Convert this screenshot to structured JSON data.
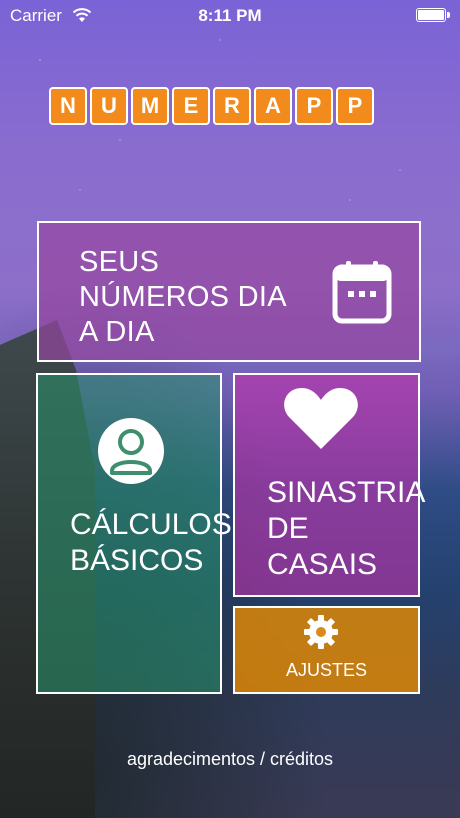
{
  "status_bar": {
    "carrier": "Carrier",
    "time": "8:11 PM",
    "battery_level": 1.0
  },
  "logo": {
    "letters": [
      "N",
      "U",
      "M",
      "E",
      "R",
      "A",
      "P",
      "P"
    ]
  },
  "tiles": {
    "daily": {
      "label_lines": [
        "SEUS",
        "NÚMEROS DIA",
        "A DIA"
      ],
      "icon": "calendar-icon"
    },
    "basic": {
      "label_lines": [
        "CÁLCULOS",
        "BÁSICOS"
      ],
      "icon": "person-icon"
    },
    "synastry": {
      "label_lines": [
        "SINASTRIA",
        "DE",
        "CASAIS"
      ],
      "icon": "heart-icon"
    },
    "settings": {
      "label": "AJUSTES",
      "icon": "gear-icon"
    }
  },
  "footer": {
    "credits": "agradecimentos / créditos"
  },
  "colors": {
    "logo_tile": "#f28a1c",
    "daily_tile": "#9646a0",
    "basic_tile": "#28966e",
    "synastry_tile": "#be32aa",
    "settings_tile": "#e88c00"
  }
}
